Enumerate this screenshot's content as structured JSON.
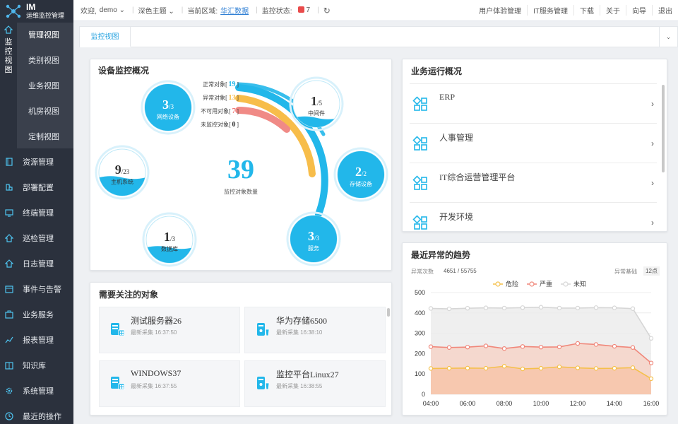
{
  "app": {
    "logo_title": "IM",
    "logo_subtitle": "运维监控管理",
    "monitor_label_chars": [
      "监",
      "控",
      "视",
      "图"
    ]
  },
  "sidebar": {
    "submenu": [
      "管理视图",
      "类别视图",
      "业务视图",
      "机房视图",
      "定制视图"
    ],
    "items": [
      {
        "label": "资源管理",
        "icon": "book-icon"
      },
      {
        "label": "部署配置",
        "icon": "puzzle-icon"
      },
      {
        "label": "终端管理",
        "icon": "monitor-icon"
      },
      {
        "label": "巡检管理",
        "icon": "home-icon"
      },
      {
        "label": "日志管理",
        "icon": "home-icon"
      },
      {
        "label": "事件与告警",
        "icon": "calendar-icon"
      },
      {
        "label": "业务服务",
        "icon": "briefcase-icon"
      },
      {
        "label": "报表管理",
        "icon": "chart-line-icon"
      },
      {
        "label": "知识库",
        "icon": "book-open-icon"
      },
      {
        "label": "系统管理",
        "icon": "gear-icon"
      },
      {
        "label": "最近的操作",
        "icon": "clock-icon"
      }
    ]
  },
  "topbar": {
    "welcome": "欢迎,",
    "user": "demo",
    "theme": "深色主题",
    "region_label": "当前区域:",
    "region": "华汇数据",
    "status_label": "监控状态:",
    "status_count": "7",
    "links": [
      "用户体验管理",
      "IT服务管理",
      "下载",
      "关于",
      "向导",
      "退出"
    ]
  },
  "tabs": {
    "active": "监控视图"
  },
  "devices": {
    "title": "设备监控概况",
    "total": "39",
    "total_label": "监控对象数量",
    "legend": [
      {
        "label": "正常对象",
        "value": "19",
        "color": "#22b7ea"
      },
      {
        "label": "异常对象",
        "value": "13",
        "color": "#f7bd4a"
      },
      {
        "label": "不可用对象",
        "value": "7",
        "color": "#f07c7c"
      },
      {
        "label": "未监控对象",
        "value": "0",
        "color": "#555555"
      }
    ],
    "gauges": [
      {
        "name": "网络设备",
        "num": "3",
        "den": "/3",
        "fill": 1.0
      },
      {
        "name": "中间件",
        "num": "1",
        "den": "/5",
        "fill": 0.2
      },
      {
        "name": "主机系统",
        "num": "9",
        "den": "/23",
        "fill": 0.39
      },
      {
        "name": "存储设备",
        "num": "2",
        "den": "/2",
        "fill": 1.0
      },
      {
        "name": "数据库",
        "num": "1",
        "den": "/3",
        "fill": 0.33
      },
      {
        "name": "服务",
        "num": "3",
        "den": "/3",
        "fill": 1.0
      }
    ]
  },
  "business": {
    "title": "业务运行概况",
    "items": [
      "ERP",
      "人事管理",
      "IT综合运营管理平台",
      "开发环境"
    ]
  },
  "focus": {
    "title": "需要关注的对象",
    "items": [
      {
        "name": "测试服务器26",
        "time": "最新采集 16:37:50",
        "icon": "server-icon"
      },
      {
        "name": "华为存储6500",
        "time": "最新采集 16:38:10",
        "icon": "storage-icon"
      },
      {
        "name": "WINDOWS37",
        "time": "最新采集 16:37:55",
        "icon": "server-icon"
      },
      {
        "name": "监控平台Linux27",
        "time": "最新采集 16:38:55",
        "icon": "storage-icon"
      }
    ]
  },
  "trend": {
    "title": "最近异常的趋势",
    "meta_label": "异常次数",
    "meta_value": "4651 / 55755",
    "base_label": "异常基础",
    "badge": "12点"
  },
  "chart_data": {
    "type": "area",
    "categories": [
      "04:00",
      "05:00",
      "06:00",
      "07:00",
      "08:00",
      "09:00",
      "10:00",
      "11:00",
      "12:00",
      "13:00",
      "14:00",
      "15:00",
      "16:00"
    ],
    "x_tick_labels": [
      "04:00",
      "06:00",
      "08:00",
      "10:00",
      "12:00",
      "14:00",
      "16:00"
    ],
    "ylim": [
      0,
      500
    ],
    "y_ticks": [
      "0",
      "100",
      "200",
      "300",
      "400",
      "500"
    ],
    "legend_position": "top-center",
    "series": [
      {
        "name": "危险",
        "color": "#f5c04a",
        "values": [
          127,
          128,
          129,
          128,
          138,
          125,
          128,
          135,
          130,
          127,
          128,
          131,
          77
        ]
      },
      {
        "name": "严重",
        "color": "#f0877a",
        "values": [
          234,
          230,
          232,
          238,
          225,
          235,
          232,
          233,
          250,
          245,
          236,
          230,
          154
        ]
      },
      {
        "name": "未知",
        "color": "#d6d6d6",
        "values": [
          422,
          420,
          423,
          425,
          424,
          426,
          428,
          424,
          424,
          426,
          425,
          421,
          275
        ]
      }
    ]
  }
}
